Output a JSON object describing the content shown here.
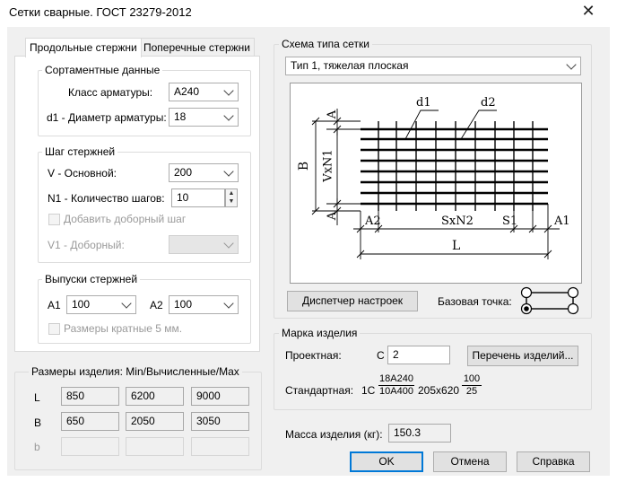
{
  "window": {
    "title": "Сетки сварные. ГОСТ 23279-2012"
  },
  "tabs": {
    "longitudinal": "Продольные стержни",
    "transverse": "Поперечные стержни"
  },
  "assortment": {
    "group_label": "Сортаментные данные",
    "class_label": "Класс арматуры:",
    "class_value": "A240",
    "d1_label": "d1 - Диаметр арматуры:",
    "d1_value": "18"
  },
  "step": {
    "group_label": "Шаг стержней",
    "v_label": "V  - Основной:",
    "v_value": "200",
    "n1_label": "N1 - Количество шагов:",
    "n1_value": "10",
    "extra_label": "Добавить доборный шаг",
    "v1_label": "V1 - Доборный:",
    "v1_value": ""
  },
  "outlets": {
    "group_label": "Выпуски стержней",
    "a1_label": "A1",
    "a1_value": "100",
    "a2_label": "A2",
    "a2_value": "100",
    "multiple_label": "Размеры кратные 5 мм."
  },
  "sizes": {
    "group_label": "Размеры изделия: Min/Вычисленные/Max",
    "rows": [
      {
        "label": "L",
        "min": "850",
        "calc": "6200",
        "max": "9000"
      },
      {
        "label": "B",
        "min": "650",
        "calc": "2050",
        "max": "3050"
      },
      {
        "label": "b",
        "min": "",
        "calc": "",
        "max": ""
      }
    ]
  },
  "schema": {
    "group_label": "Схема типа сетки",
    "type_value": "Тип 1, тяжелая плоская",
    "labels": {
      "d1": "d1",
      "d2": "d2",
      "a_top": "A",
      "a_bottom": "A",
      "b": "B",
      "vxn1": "VxN1",
      "a2": "A2",
      "sxn2": "SxN2",
      "s1": "S1",
      "a1": "A1",
      "l": "L"
    },
    "settings_button": "Диспетчер настроек",
    "base_point_label": "Базовая точка:"
  },
  "mark": {
    "group_label": "Марка изделия",
    "project_label": "Проектная:",
    "project_prefix": "С",
    "project_value": "2",
    "list_button": "Перечень изделий...",
    "standard_label": "Стандартная:",
    "standard_prefix": "1С",
    "frac1_num": "18A240",
    "frac1_den": "10A400",
    "dims": "205х620",
    "frac2_num": "100",
    "frac2_den": "25"
  },
  "mass": {
    "label": "Масса изделия (кг):",
    "value": "150.3"
  },
  "buttons": {
    "ok": "OK",
    "cancel": "Отмена",
    "help": "Справка"
  }
}
